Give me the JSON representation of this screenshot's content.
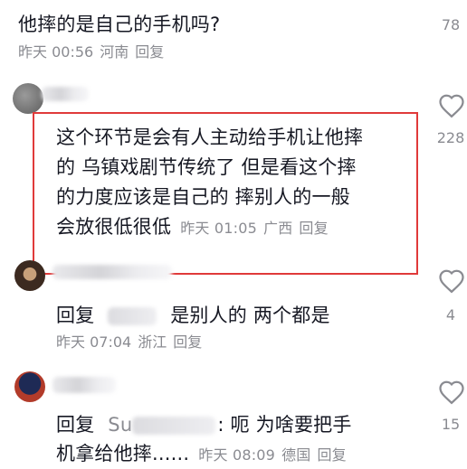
{
  "comment0": {
    "text": "他摔的是自己的手机吗?",
    "meta": {
      "time": "昨天 00:56",
      "location": "河南",
      "reply": "回复"
    },
    "likes": "78"
  },
  "comment1": {
    "lines": [
      "这个环节是会有人主动给手机让他摔",
      "的  乌镇戏剧节传统了  但是看这个摔",
      "的力度应该是自己的  摔别人的一般",
      "会放很低很低"
    ],
    "meta": {
      "time": "昨天 01:05",
      "location": "广西",
      "reply": "回复"
    },
    "likes": "228"
  },
  "reply1": {
    "prefix": "回复",
    "text": "是别人的  两个都是",
    "meta": {
      "time": "昨天 07:04",
      "location": "浙江",
      "reply": "回复"
    },
    "likes": "4"
  },
  "reply2": {
    "prefix": "回复",
    "partial_name": "Su",
    "text_line1": ":  呃  为啥要把手",
    "text_line2": "机拿给他摔......",
    "meta": {
      "time": "昨天 08:09",
      "location": "德国",
      "reply": "回复"
    },
    "likes": "15"
  },
  "colors": {
    "highlight": "#e03a3a",
    "meta_gray": "#8a8b91",
    "text": "#161823"
  },
  "icons": [
    "heart-outline-icon",
    "avatar"
  ]
}
